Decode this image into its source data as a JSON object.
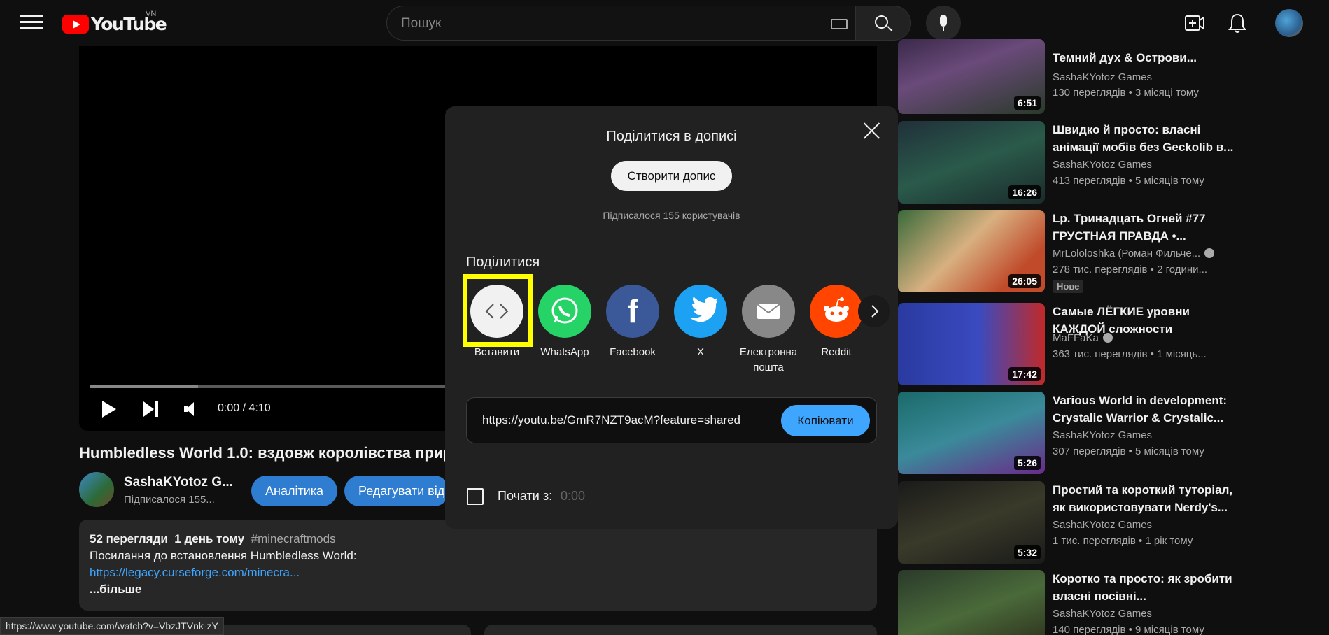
{
  "header": {
    "logo_text": "YouTube",
    "country_code": "VN",
    "search_placeholder": "Пошук"
  },
  "player": {
    "time": "0:00 / 4:10",
    "progress_buffered_fraction": 0.14
  },
  "video": {
    "title": "Humbledless World 1.0: вздовж королівства прир",
    "channel_name": "SashaKYotoz G...",
    "channel_subs": "Підписалося 155...",
    "analytics_label": "Аналітика",
    "edit_label": "Редагувати від",
    "description": {
      "views": "52 перегляди",
      "date": "1 день тому",
      "hashtag": "#minecraftmods",
      "line1": "Посилання до встановлення Humbledless World:",
      "link": "https://legacy.curseforge.com/minecra...",
      "more": "...більше"
    }
  },
  "status_url": "https://www.youtube.com/watch?v=VbzJTVnk-zY",
  "share_modal": {
    "title": "Поділитися в дописі",
    "create_post_label": "Створити допис",
    "subscribers_text": "Підписалося 155 користувачів",
    "share_label": "Поділитися",
    "targets": [
      {
        "label": "Вставити",
        "icon": "embed-icon",
        "color": "#f1f1f1"
      },
      {
        "label": "WhatsApp",
        "icon": "whatsapp-icon",
        "color": "#25d366"
      },
      {
        "label": "Facebook",
        "icon": "facebook-icon",
        "color": "#3b5998"
      },
      {
        "label": "X",
        "icon": "twitter-icon",
        "color": "#1da1f2"
      },
      {
        "label": "Електронна пошта",
        "icon": "email-icon",
        "color": "#888888"
      },
      {
        "label": "Reddit",
        "icon": "reddit-icon",
        "color": "#ff4500"
      }
    ],
    "url": "https://youtu.be/GmR7NZT9acM?feature=shared",
    "copy_label": "Копіювати",
    "start_at_label": "Почати з:",
    "start_at_value": "0:00"
  },
  "recommendations": [
    {
      "title": "Темний дух & Острови...",
      "channel": "SashaKYotoz Games",
      "meta": "130 переглядів  • 3 місяці тому",
      "duration": "6:51"
    },
    {
      "title": "Швидко й просто: власні анімації мобів без Geckolib в...",
      "channel": "SashaKYotoz Games",
      "meta": "413 переглядів  • 5 місяців тому",
      "duration": "16:26"
    },
    {
      "title": "Lp. Тринадцать Огней #77 ГРУСТНАЯ ПРАВДА •...",
      "channel": "MrLololoshka (Роман Фильче...",
      "meta": "278 тис. переглядів  • 2 години...",
      "duration": "26:05",
      "badge": "Нове"
    },
    {
      "title": "Самые ЛЁГКИЕ уровни КАЖДОЙ сложности",
      "channel": "MaFFaKa",
      "meta": "363 тис. переглядів  • 1 місяць...",
      "duration": "17:42"
    },
    {
      "title": "Various World in development: Crystalic Warrior & Crystalic...",
      "channel": "SashaKYotoz Games",
      "meta": "307 переглядів  • 5 місяців тому",
      "duration": "5:26"
    },
    {
      "title": "Простий та короткий туторіал, як використовувати Nerdy's...",
      "channel": "SashaKYotoz Games",
      "meta": "1 тис. переглядів  • 1 рік тому",
      "duration": "5:32"
    },
    {
      "title": "Коротко та просто: як зробити власні посівні...",
      "channel": "SashaKYotoz Games",
      "meta": "140 переглядів  • 9 місяців тому",
      "duration": ""
    }
  ]
}
